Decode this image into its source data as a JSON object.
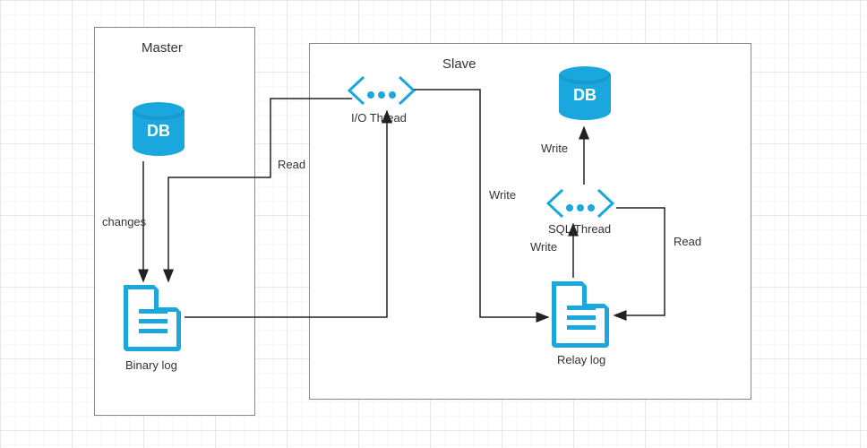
{
  "master": {
    "title": "Master",
    "db_label": "DB",
    "changes_label": "changes",
    "binary_log_label": "Binary log"
  },
  "slave": {
    "title": "Slave",
    "db_label": "DB",
    "io_thread_label": "I/O Thread",
    "sql_thread_label": "SQL Thread",
    "relay_log_label": "Relay log"
  },
  "edges": {
    "read_master": "Read",
    "write_io_to_relay": "Write",
    "write_relay_to_sql": "Write",
    "read_relay_to_sql": "Read",
    "write_sql_to_db": "Write"
  },
  "colors": {
    "accent": "#19a7dd"
  }
}
